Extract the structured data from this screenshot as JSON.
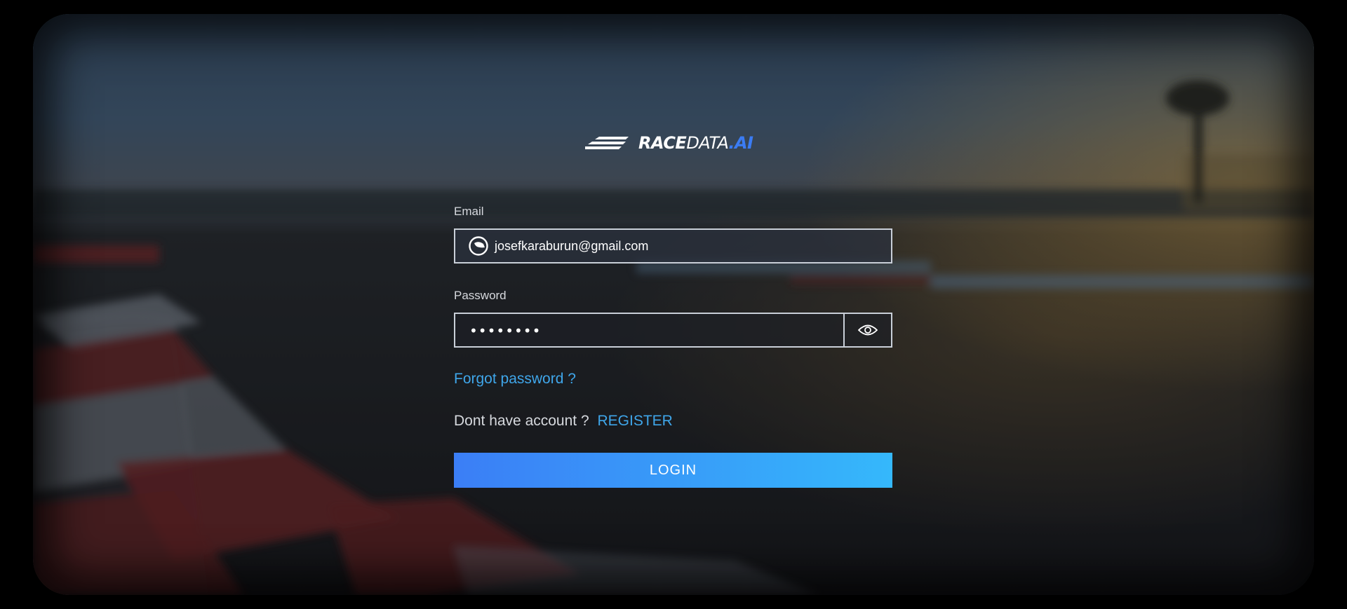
{
  "brand": {
    "name_part1": "RACE",
    "name_part2": "DATA",
    "name_part3": ".AI"
  },
  "form": {
    "email_label": "Email",
    "email_value": "josefkaraburun@gmail.com",
    "password_label": "Password",
    "password_value": "••••••••",
    "forgot_link": "Forgot password ?",
    "no_account_text": "Dont have account ?",
    "register_link": "REGISTER",
    "login_button": "LOGIN"
  },
  "icons": {
    "email_field": "helmet-icon",
    "password_toggle": "eye-icon",
    "logo": "speed-lines-logo-icon"
  },
  "colors": {
    "accent": "#3fa6ea",
    "login_gradient_start": "#3b7ef6",
    "login_gradient_end": "#35b8fb",
    "brand_ai": "#3b7cf3"
  }
}
